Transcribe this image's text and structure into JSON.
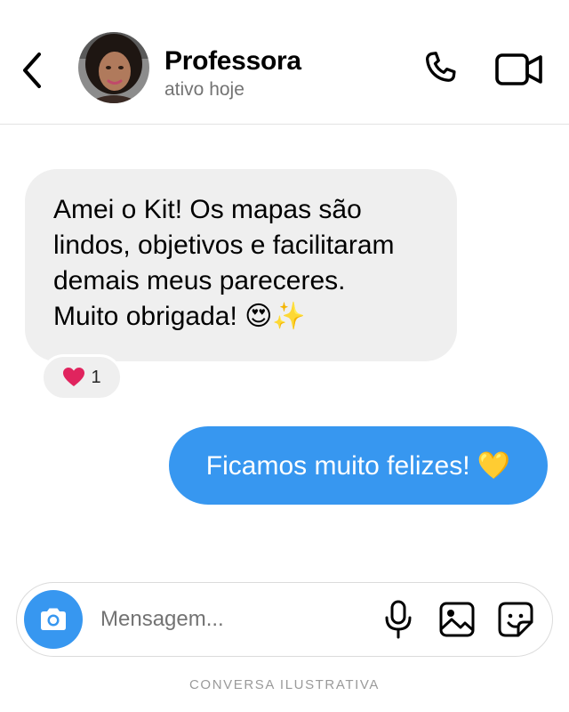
{
  "header": {
    "name": "Professora",
    "status": "ativo hoje"
  },
  "icons": {
    "back": "chevron-left-icon",
    "call": "phone-icon",
    "video": "video-camera-icon",
    "camera": "camera-icon",
    "mic": "microphone-icon",
    "gallery": "image-icon",
    "sticker": "sticker-icon"
  },
  "messages": {
    "incoming": {
      "lines": [
        "Amei o Kit! Os mapas são",
        "lindos, objetivos e facilitaram",
        "demais meus pareceres.",
        "Muito obrigada! 😍✨"
      ],
      "reaction": {
        "emoji": "❤️",
        "count": "1"
      }
    },
    "outgoing": {
      "text": "Ficamos muito felizes! 💛"
    }
  },
  "composer": {
    "placeholder": "Mensagem..."
  },
  "footer": {
    "caption": "CONVERSA ILUSTRATIVA"
  },
  "colors": {
    "accent": "#3797f0",
    "incoming_bubble": "#efefef",
    "reaction_heart": "#e0245e",
    "avatar_bg": "#6b4a3a"
  }
}
